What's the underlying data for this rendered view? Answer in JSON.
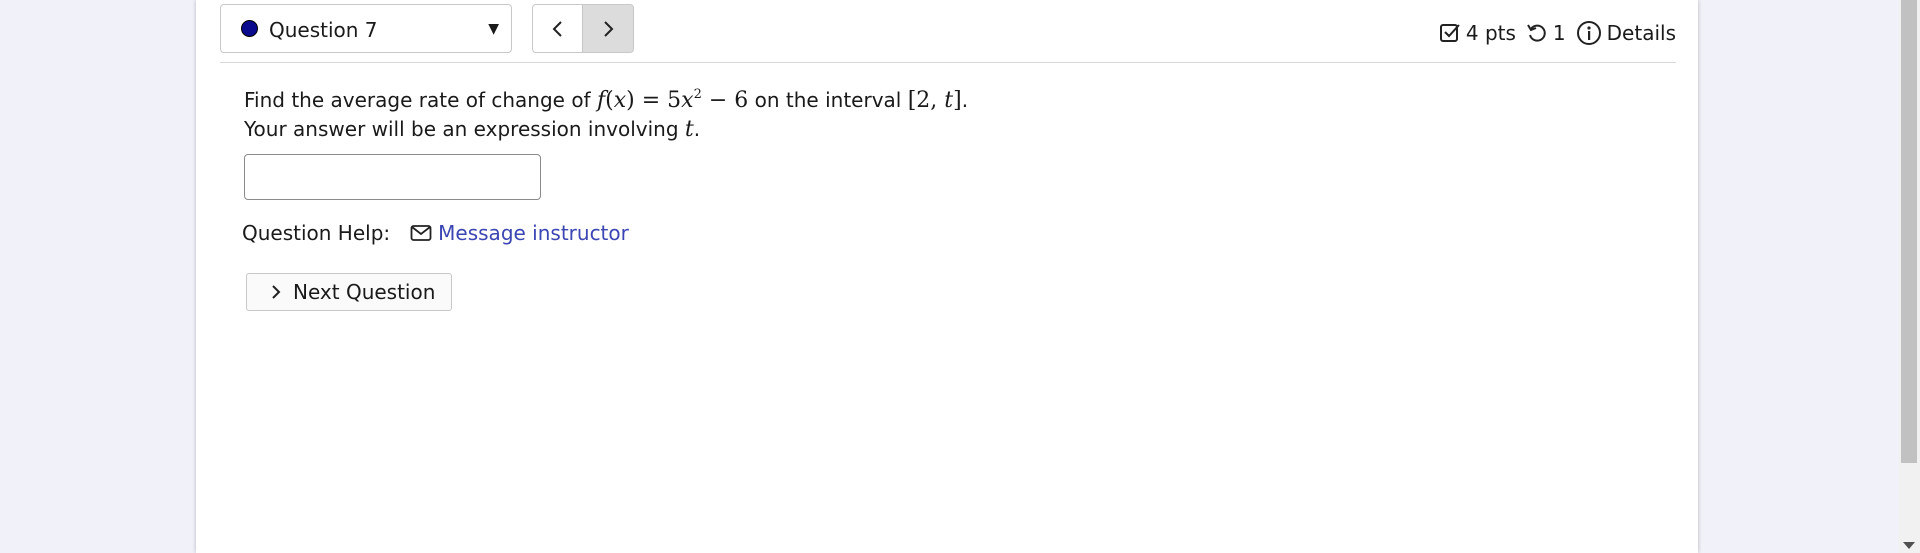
{
  "header": {
    "question_select": {
      "label": "Question 7",
      "status_color": "#0a0a8c"
    },
    "nav": {
      "prev_icon": "chevron-left-icon",
      "next_icon": "chevron-right-icon"
    },
    "meta": {
      "points": "4 pts",
      "attempts": "1",
      "details": "Details"
    }
  },
  "question": {
    "line1_prefix": "Find the average rate of change of",
    "line1_middle": "on the interval",
    "line1_suffix": ".",
    "function_expr": {
      "f": "f",
      "open": "(",
      "x": "x",
      "close": ")",
      "eq": " = 5",
      "x2": "x",
      "exp": "2",
      "rest": " − 6"
    },
    "interval_expr": {
      "open": "[2, ",
      "t": "t",
      "close": "]"
    },
    "line2_prefix": "Your answer will be an expression involving",
    "line2_var": "t",
    "line2_suffix": "."
  },
  "answer": {
    "value": "",
    "placeholder": ""
  },
  "help": {
    "label": "Question Help:",
    "link": "Message instructor"
  },
  "next_button": {
    "label": "Next Question"
  },
  "colors": {
    "page_bg": "#f1f2f9",
    "link": "#3b46b3",
    "status_dot": "#0a0a8c"
  }
}
